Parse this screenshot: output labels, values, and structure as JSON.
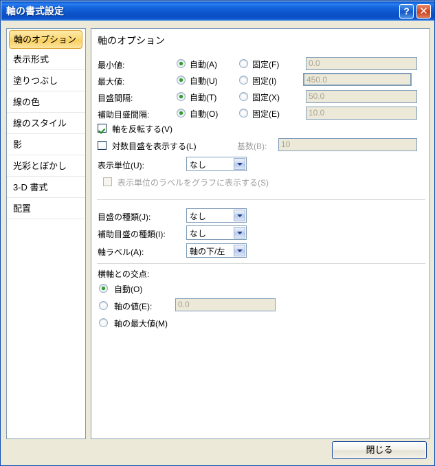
{
  "window": {
    "title": "軸の書式設定",
    "help_button": "?",
    "close_button": "✕"
  },
  "sidebar": {
    "items": [
      {
        "label": "軸のオプション",
        "selected": true
      },
      {
        "label": "表示形式",
        "selected": false
      },
      {
        "label": "塗りつぶし",
        "selected": false
      },
      {
        "label": "線の色",
        "selected": false
      },
      {
        "label": "線のスタイル",
        "selected": false
      },
      {
        "label": "影",
        "selected": false
      },
      {
        "label": "光彩とぼかし",
        "selected": false
      },
      {
        "label": "3-D 書式",
        "selected": false
      },
      {
        "label": "配置",
        "selected": false
      }
    ]
  },
  "main": {
    "heading": "軸のオプション",
    "scale_rows": [
      {
        "label": "最小値:",
        "auto_label": "自動(A)",
        "fixed_label": "固定(F)",
        "value": "0.0",
        "selected": "auto"
      },
      {
        "label": "最大値:",
        "auto_label": "自動(U)",
        "fixed_label": "固定(I)",
        "value": "450.0",
        "selected": "auto"
      },
      {
        "label": "目盛間隔:",
        "auto_label": "自動(T)",
        "fixed_label": "固定(X)",
        "value": "50.0",
        "selected": "auto"
      },
      {
        "label": "補助目盛間隔:",
        "auto_label": "自動(O)",
        "fixed_label": "固定(E)",
        "value": "10.0",
        "selected": "auto"
      }
    ],
    "reverse_axis": {
      "label": "軸を反転する(V)",
      "checked": true
    },
    "log_scale": {
      "label": "対数目盛を表示する(L)",
      "checked": false
    },
    "log_base": {
      "label": "基数(B):",
      "value": "10",
      "enabled": false
    },
    "display_unit": {
      "label": "表示単位(U):",
      "value": "なし"
    },
    "show_unit_label": {
      "label": "表示単位のラベルをグラフに表示する(S)",
      "checked": false,
      "enabled": false
    },
    "major_tick": {
      "label": "目盛の種類(J):",
      "value": "なし"
    },
    "minor_tick": {
      "label": "補助目盛の種類(I):",
      "value": "なし"
    },
    "axis_labels": {
      "label": "軸ラベル(A):",
      "value": "軸の下/左"
    },
    "crosses": {
      "title": "横軸との交点:",
      "options": [
        {
          "label": "自動(O)",
          "selected": true
        },
        {
          "label": "軸の値(E):",
          "selected": false
        },
        {
          "label": "軸の最大値(M)",
          "selected": false
        }
      ],
      "value": "0.0"
    }
  },
  "footer": {
    "close_label": "閉じる"
  }
}
